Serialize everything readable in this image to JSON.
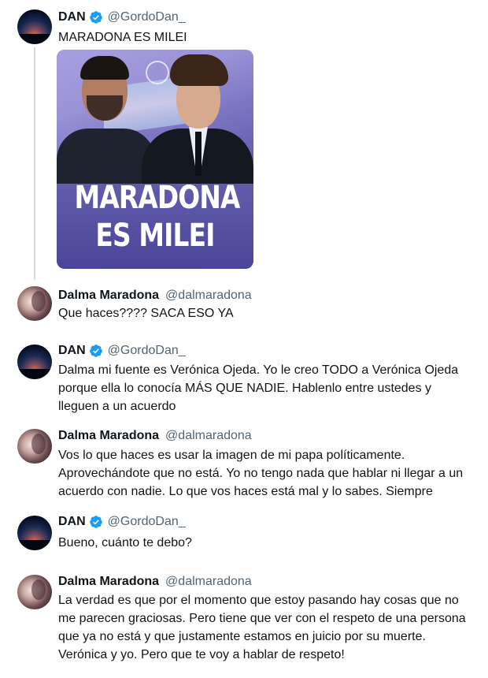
{
  "colors": {
    "verified": "#1d9bf0",
    "handle": "#536471",
    "text": "#0f1419",
    "media_accent": "#4a4596"
  },
  "icons": {
    "verified": "verified-badge-icon"
  },
  "thread": [
    {
      "author": "DAN",
      "handle": "@GordoDan_",
      "verified": true,
      "text": "MARADONA ES MILEI",
      "media": {
        "line1": "MARADONA",
        "line2": "ES MILEI"
      }
    },
    {
      "author": "Dalma Maradona",
      "handle": "@dalmaradona",
      "verified": false,
      "text": "Que haces???? SACA ESO YA"
    },
    {
      "author": "DAN",
      "handle": "@GordoDan_",
      "verified": true,
      "text": "Dalma mi fuente es Verónica Ojeda. Yo le creo TODO a Verónica Ojeda porque ella lo conocía MÁS QUE NADIE. Hablenlo entre ustedes y lleguen a un acuerdo"
    },
    {
      "author": "Dalma Maradona",
      "handle": "@dalmaradona",
      "verified": false,
      "text": "Vos lo que haces es usar la imagen de mi papa políticamente. Aprovechándote que no está. Yo no tengo nada que hablar ni llegar a un acuerdo con nadie. Lo que vos haces está mal y lo sabes. Siempre"
    },
    {
      "author": "DAN",
      "handle": "@GordoDan_",
      "verified": true,
      "text": "Bueno, cuánto te debo?"
    },
    {
      "author": "Dalma Maradona",
      "handle": "@dalmaradona",
      "verified": false,
      "text": "La verdad es que por el momento que estoy pasando hay cosas que no me parecen graciosas. Pero tiene que ver con el respeto de una persona que ya no está y que justamente estamos en juicio por su muerte. Verónica y yo. Pero  que te voy a hablar de respeto!"
    }
  ]
}
